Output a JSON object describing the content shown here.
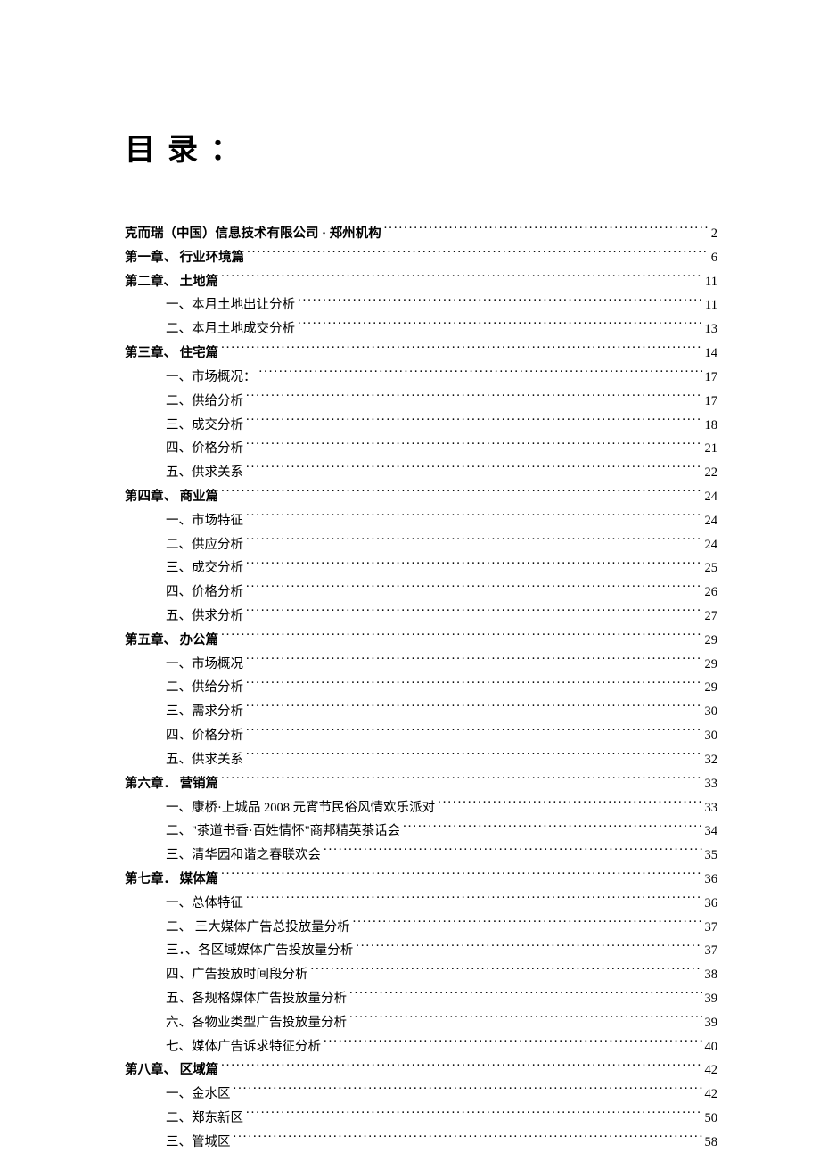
{
  "title": "目录：",
  "toc": [
    {
      "level": 1,
      "label": "克而瑞（中国）信息技术有限公司 · 郑州机构",
      "page": "2"
    },
    {
      "level": 1,
      "label": "第一章、 行业环境篇",
      "page": "6"
    },
    {
      "level": 1,
      "label": "第二章、 土地篇",
      "page": "11"
    },
    {
      "level": 2,
      "label": "一、本月土地出让分析",
      "page": "11"
    },
    {
      "level": 2,
      "label": "二、本月土地成交分析",
      "page": "13"
    },
    {
      "level": 1,
      "label": "第三章、 住宅篇",
      "page": "14"
    },
    {
      "level": 2,
      "label": "一、市场概况：",
      "page": "17"
    },
    {
      "level": 2,
      "label": "二、供给分析",
      "page": "17"
    },
    {
      "level": 2,
      "label": "三、成交分析",
      "page": "18"
    },
    {
      "level": 2,
      "label": "四、价格分析",
      "page": "21"
    },
    {
      "level": 2,
      "label": "五、供求关系",
      "page": "22"
    },
    {
      "level": 1,
      "label": "第四章、 商业篇",
      "page": "24"
    },
    {
      "level": 2,
      "label": "一、市场特征",
      "page": "24"
    },
    {
      "level": 2,
      "label": "二、供应分析",
      "page": "24"
    },
    {
      "level": 2,
      "label": "三、成交分析",
      "page": "25"
    },
    {
      "level": 2,
      "label": "四、价格分析",
      "page": "26"
    },
    {
      "level": 2,
      "label": "五、供求分析",
      "page": "27"
    },
    {
      "level": 1,
      "label": "第五章、 办公篇",
      "page": "29"
    },
    {
      "level": 2,
      "label": "一、市场概况",
      "page": "29"
    },
    {
      "level": 2,
      "label": "二、供给分析",
      "page": "29"
    },
    {
      "level": 2,
      "label": "三、需求分析",
      "page": "30"
    },
    {
      "level": 2,
      "label": "四、价格分析",
      "page": "30"
    },
    {
      "level": 2,
      "label": "五、供求关系",
      "page": "32"
    },
    {
      "level": 1,
      "label": "第六章． 营销篇",
      "page": "33"
    },
    {
      "level": 2,
      "label": "一、康桥·上城品 2008 元宵节民俗风情欢乐派对",
      "page": "33"
    },
    {
      "level": 2,
      "label": "二、\"茶道书香·百姓情怀\"商邦精英茶话会",
      "page": "34"
    },
    {
      "level": 2,
      "label": "三、清华园和谐之春联欢会",
      "page": "35"
    },
    {
      "level": 1,
      "label": "第七章． 媒体篇",
      "page": "36"
    },
    {
      "level": 2,
      "label": "一、总体特征",
      "page": "36"
    },
    {
      "level": 2,
      "label": "二、 三大媒体广告总投放量分析",
      "page": "37"
    },
    {
      "level": 2,
      "label": "三．、各区域媒体广告投放量分析",
      "page": "37"
    },
    {
      "level": 2,
      "label": "四、广告投放时间段分析",
      "page": "38"
    },
    {
      "level": 2,
      "label": "五、各规格媒体广告投放量分析",
      "page": "39"
    },
    {
      "level": 2,
      "label": "六、各物业类型广告投放量分析",
      "page": "39"
    },
    {
      "level": 2,
      "label": "七、媒体广告诉求特征分析",
      "page": "40"
    },
    {
      "level": 1,
      "label": "第八章、 区域篇",
      "page": "42"
    },
    {
      "level": 2,
      "label": "一、金水区",
      "page": "42"
    },
    {
      "level": 2,
      "label": "二、郑东新区",
      "page": "50"
    },
    {
      "level": 2,
      "label": "三、管城区",
      "page": "58"
    }
  ]
}
